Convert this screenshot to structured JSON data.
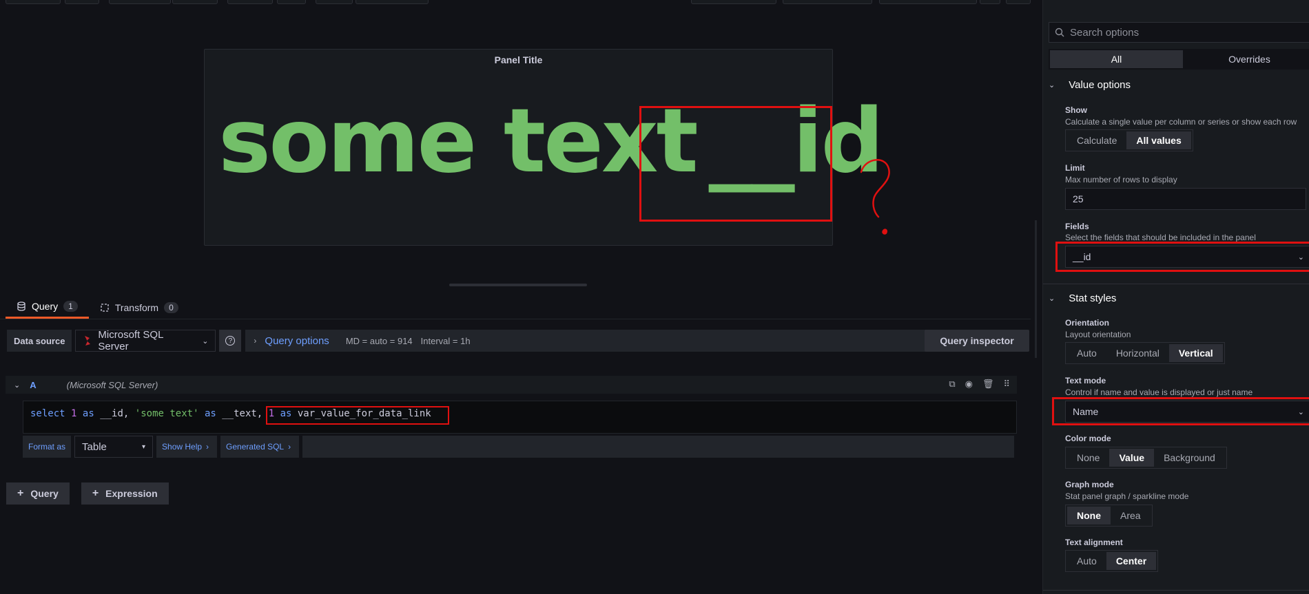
{
  "panel": {
    "title": "Panel Title",
    "value_text": "some text",
    "value_id": "__id"
  },
  "query_tabs": [
    {
      "label": "Query",
      "count": "1"
    },
    {
      "label": "Transform",
      "count": "0"
    }
  ],
  "query_row": {
    "datasource_label": "Data source",
    "datasource_value": "Microsoft SQL Server",
    "help": "?",
    "query_options": "Query options",
    "md": "MD = auto = 914",
    "interval": "Interval = 1h",
    "inspector": "Query inspector"
  },
  "query": {
    "ref_id": "A",
    "datasource": "(Microsoft SQL Server)",
    "sql": {
      "t1": "select",
      "t2": "1",
      "t3": "as",
      "t4": "__id,",
      "t5": "'some text'",
      "t6": "as",
      "t7": "__text,",
      "t8": "1",
      "t9": "as",
      "t10": "var_value_for_data_link"
    },
    "format_as_label": "Format as",
    "format_as_value": "Table",
    "show_help": "Show Help",
    "generated_sql": "Generated SQL"
  },
  "add_buttons": {
    "query": "Query",
    "expression": "Expression"
  },
  "options": {
    "search_placeholder": "Search options",
    "tabs": [
      "All",
      "Overrides"
    ],
    "value_options": {
      "header": "Value options",
      "show_label": "Show",
      "show_desc": "Calculate a single value per column or series or show each row",
      "show_options": [
        "Calculate",
        "All values"
      ],
      "show_selected": "All values",
      "limit_label": "Limit",
      "limit_desc": "Max number of rows to display",
      "limit_value": "25",
      "fields_label": "Fields",
      "fields_desc": "Select the fields that should be included in the panel",
      "fields_value": "__id"
    },
    "stat_styles": {
      "header": "Stat styles",
      "orientation_label": "Orientation",
      "orientation_desc": "Layout orientation",
      "orientation_options": [
        "Auto",
        "Horizontal",
        "Vertical"
      ],
      "orientation_selected": "Vertical",
      "text_mode_label": "Text mode",
      "text_mode_desc": "Control if name and value is displayed or just name",
      "text_mode_value": "Name",
      "color_mode_label": "Color mode",
      "color_mode_options": [
        "None",
        "Value",
        "Background"
      ],
      "color_mode_selected": "Value",
      "graph_mode_label": "Graph mode",
      "graph_mode_desc": "Stat panel graph / sparkline mode",
      "graph_mode_options": [
        "None",
        "Area"
      ],
      "graph_mode_selected": "None",
      "text_align_label": "Text alignment",
      "text_align_options": [
        "Auto",
        "Center"
      ],
      "text_align_selected": "Center"
    }
  },
  "colors": {
    "stat_value": "#73bf69",
    "link": "#6e9fff",
    "annotation": "#e01010",
    "active_tab": "#f05a28"
  }
}
